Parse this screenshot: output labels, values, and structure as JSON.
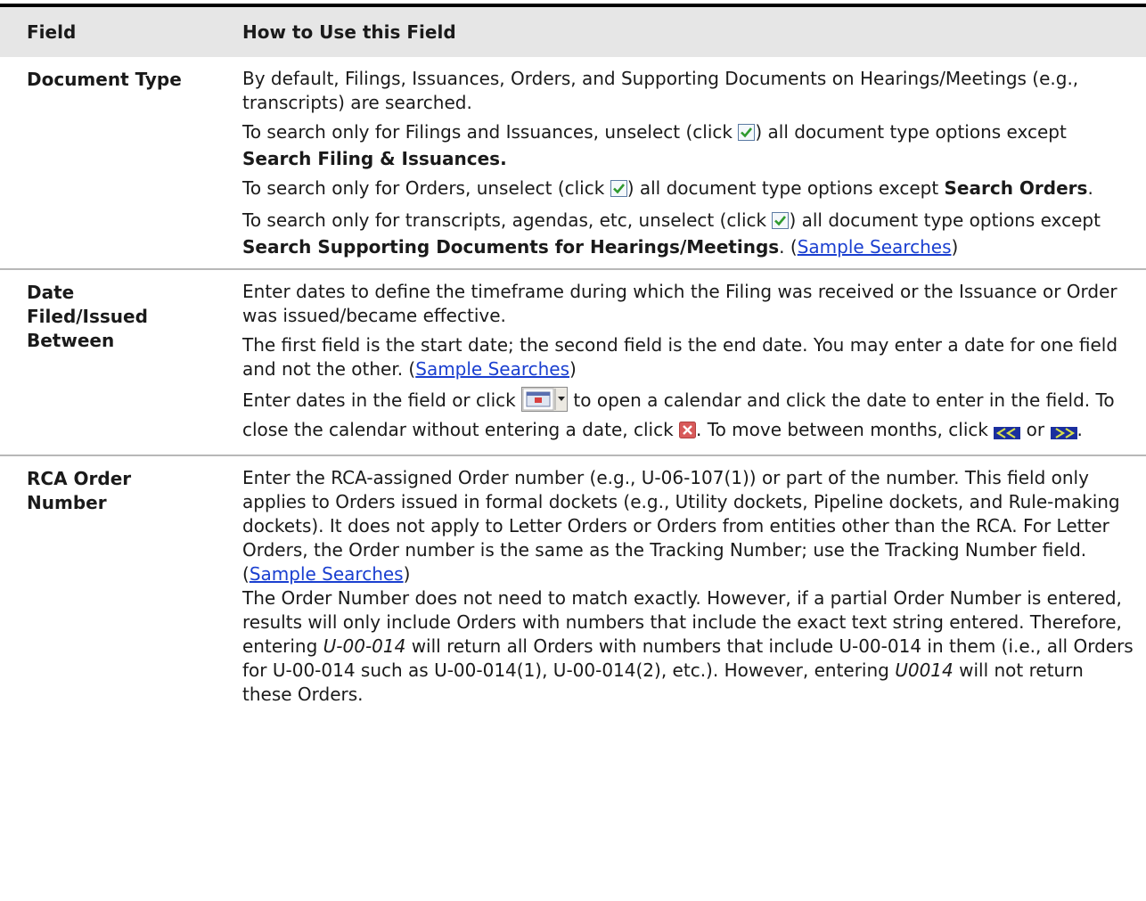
{
  "header": {
    "col_field": "Field",
    "col_how": "How to Use this Field"
  },
  "rows": {
    "doc_type": {
      "label": "Document Type",
      "p1": "By default, Filings, Issuances, Orders, and Supporting Documents on Hearings/Meetings (e.g., transcripts) are searched.",
      "p2_pre": "To search only for Filings and Issuances, unselect (click ",
      "p2_mid": ") all document type options except ",
      "p2_bold": "Search Filing & Issuances.",
      "p3_pre": "To search only for Orders, unselect (click ",
      "p3_mid": ") all document type options except ",
      "p3_bold": "Search Orders",
      "p3_post": ".",
      "p4_pre": "To search only for transcripts, agendas, etc, unselect (click ",
      "p4_mid": ") all document type options except ",
      "p4_bold": "Search Supporting Documents for Hearings/Meetings",
      "p4_post": ". (",
      "p4_link": "Sample Searches",
      "p4_close": ")"
    },
    "date": {
      "label_l1": "Date",
      "label_l2": "Filed/Issued",
      "label_l3": "Between",
      "p1": "Enter dates to define the timeframe during which the Filing was received or the Issuance or Order was issued/became effective.",
      "p2_pre": "The first field is the start date; the second field is the end date. You may enter a date for one field and not the other. (",
      "p2_link": "Sample Searches",
      "p2_close": ")",
      "p3_pre": "Enter dates in the field or click ",
      "p3_mid": " to open a calendar and click the date to enter in the field. To close the calendar without entering a date, click ",
      "p3_mid2": ". To move between months, click ",
      "p3_or": " or ",
      "p3_post": "."
    },
    "rca": {
      "label_l1": "RCA Order",
      "label_l2": "Number",
      "p1_pre": "Enter the RCA-assigned Order number (e.g., U-06-107(1)) or part of the number. This field only applies to Orders issued in formal dockets (e.g., Utility dockets, Pipeline dockets, and Rule-making dockets). It does not apply to Letter Orders or Orders from entities other than the RCA. For Letter Orders, the Order number is the same as the Tracking Number; use the Tracking Number field. (",
      "p1_link": "Sample Searches",
      "p1_close": ")",
      "p2_pre": "The Order Number does not need to match exactly. However, if a partial Order Number is entered, results will only include Orders with numbers that include the exact text string entered. Therefore, entering ",
      "p2_em1": "U-00-014",
      "p2_mid": " will return all Orders with numbers that include U-00-014 in them (i.e., all Orders for U-00-014 such as U-00-014(1), U-00-014(2), etc.). However, entering ",
      "p2_em2": "U0014",
      "p2_post": " will not return these Orders."
    }
  },
  "icons": {
    "checkbox": "checked-checkbox-icon",
    "calendar": "calendar-dropdown-icon",
    "close": "close-icon",
    "prev": "previous-month-icon",
    "next": "next-month-icon"
  },
  "colors": {
    "header_bg": "#e6e6e6",
    "link": "#1a3fd0",
    "checkbox_green": "#2f9a2f",
    "close_red": "#d85a5a",
    "nav_blue": "#1b2f9e"
  }
}
